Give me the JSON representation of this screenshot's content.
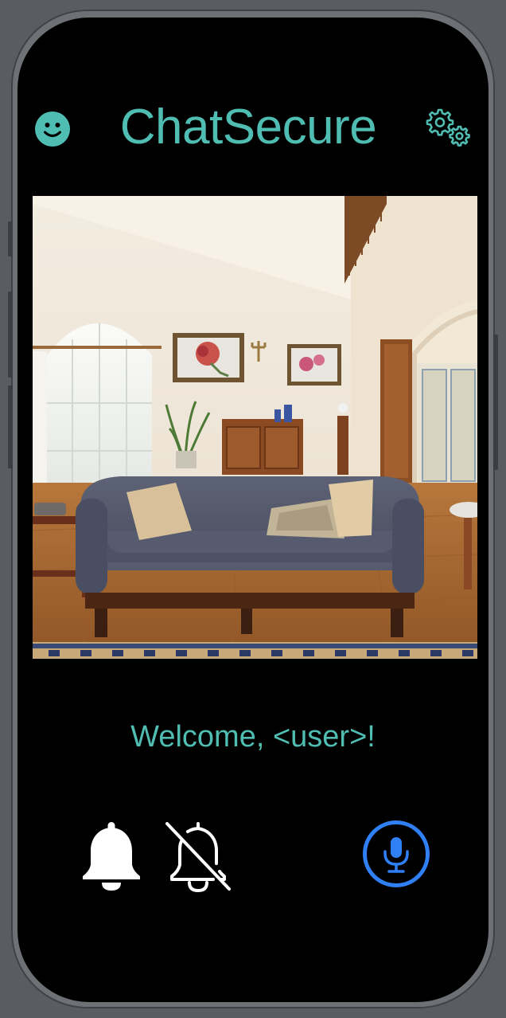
{
  "app": {
    "title": "ChatSecure",
    "welcome_message": "Welcome, <user>!"
  },
  "header": {
    "left_icon": "smiley-icon",
    "right_icon": "gears-icon"
  },
  "main": {
    "feed_image": "living-room-camera-feed"
  },
  "controls": {
    "notifications_on_icon": "bell-icon",
    "notifications_off_icon": "bell-slash-icon",
    "voice_icon": "microphone-icon"
  },
  "colors": {
    "accent": "#4fbdb2",
    "mic_blue": "#2f7ff5",
    "background": "#000000",
    "icon_white": "#ffffff"
  }
}
